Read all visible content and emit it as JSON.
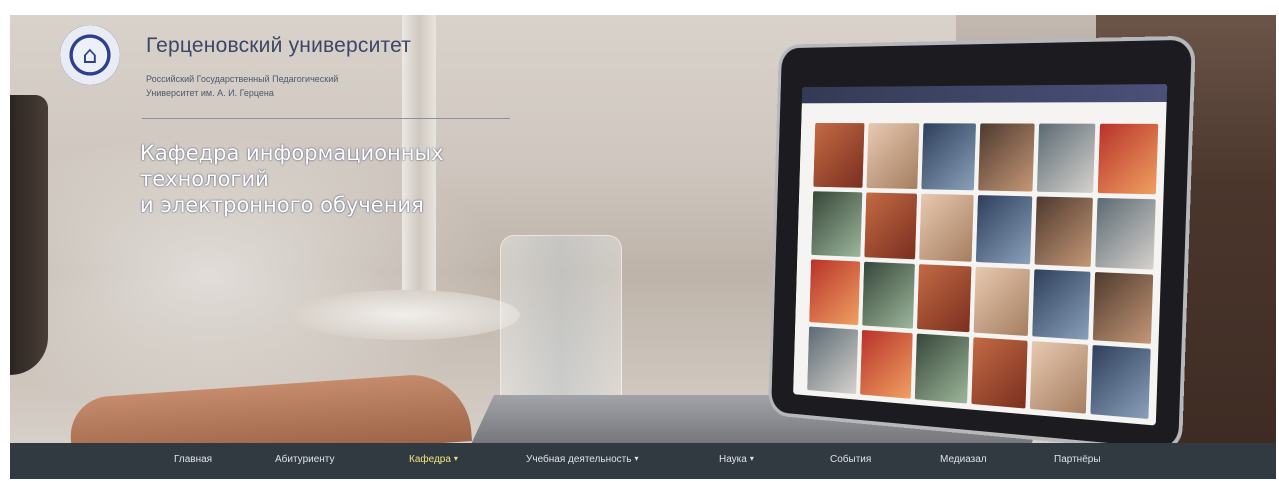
{
  "header": {
    "university_name": "Герценовский университет",
    "university_subtitle_line1": "Российский Государственный Педагогический",
    "university_subtitle_line2": "Университет им. А. И. Герцена",
    "department_line1": "Кафедра информационных",
    "department_line2": "технологий",
    "department_line3": "и электронного обучения"
  },
  "nav": {
    "items": [
      {
        "label": "Главная",
        "dropdown": false,
        "active": false
      },
      {
        "label": "Абитуриенту",
        "dropdown": false,
        "active": false
      },
      {
        "label": "Кафедра",
        "dropdown": true,
        "active": true
      },
      {
        "label": "Учебная деятельность",
        "dropdown": true,
        "active": false
      },
      {
        "label": "Наука",
        "dropdown": true,
        "active": false
      },
      {
        "label": "События",
        "dropdown": false,
        "active": false
      },
      {
        "label": "Медиазал",
        "dropdown": false,
        "active": false
      },
      {
        "label": "Партнёры",
        "dropdown": false,
        "active": false
      }
    ],
    "caret_glyph": "▾"
  },
  "colors": {
    "navbar_bg": "#313a41",
    "nav_text": "#dfe2e6",
    "nav_active": "#f2e27a",
    "brand_blue": "#2d3f8f"
  },
  "icons": {
    "logo": "university-seal-icon",
    "dropdown": "caret-down-icon"
  }
}
